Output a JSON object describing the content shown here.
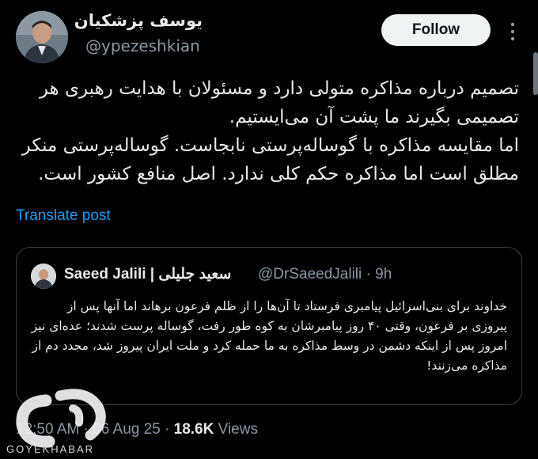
{
  "header": {
    "display_name": "یوسف پزشکیان",
    "handle": "@ypezeshkian",
    "follow_label": "Follow"
  },
  "tweet": {
    "paragraphs": [
      "تصمیم درباره مذاکره متولی دارد و مسئولان با هدایت رهبری هر تصمیمی بگیرند ما پشت آن می‌ایستیم.",
      "اما مقایسه مذاکره با گوساله‌پرستی نابجاست. گوساله‌پرستی منکر مطلق است اما مذاکره حکم کلی ندارد. اصل منافع کشور است."
    ],
    "translate_label": "Translate post"
  },
  "quote": {
    "display_name": "Saeed Jalili | سعید جلیلی",
    "handle": "@DrSaeedJalili",
    "age": "· 9h",
    "text": "خداوند برای بنی‌اسرائیل پیامبری فرستاد تا آن‌ها را از ظلم فرعون برهاند اما آنها پس از پیروزی بر فرعون، وقتی ۴۰ روز پیامبرشان به کوه طور رفت، گوساله پرست شدند؛ عده‌ای نیز امروز پس از اینکه دشمن در وسط مذاکره به ما حمله کرد و ملت ایران پیروز شد، مجدد دم از مذاکره می‌زنند!"
  },
  "footer": {
    "timestamp": "12:50 AM · 06 Aug 25 · ",
    "views_count": "18.6K",
    "views_label": " Views"
  },
  "watermark": {
    "brand": "GOYEKHABAR"
  },
  "colors": {
    "background": "#000000",
    "text": "#e7e9ea",
    "secondary": "#8b98a5",
    "accent": "#1d9bf0"
  }
}
